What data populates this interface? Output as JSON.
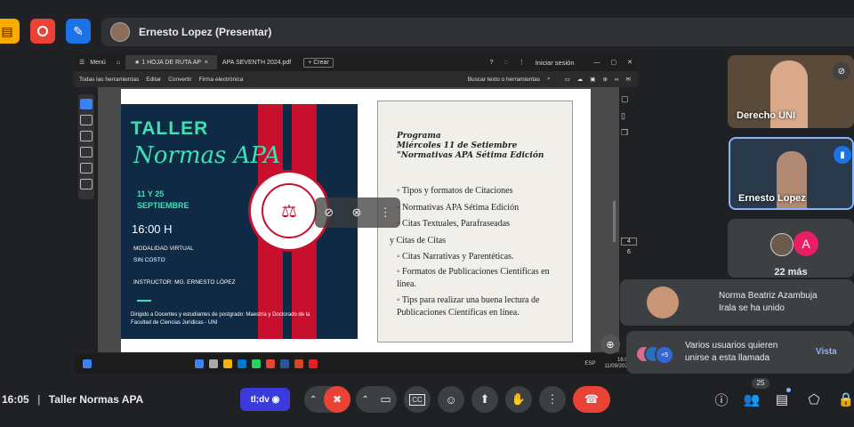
{
  "presenter": {
    "label": "Ernesto Lopez (Presentar)"
  },
  "window": {
    "menu_label": "Menú",
    "tabs": [
      "1 HOJA DE RUTA AP",
      "APA SEVENTH 2024.pdf"
    ],
    "new_tab": "+ Crear",
    "signin": "Iniciar sesión",
    "toolbar": [
      "Todas las herramientas",
      "Editar",
      "Convertir",
      "Firma electrónica"
    ],
    "search_placeholder": "Buscar texto o herramientas",
    "page_num": "4",
    "page_total": "6",
    "taskbar_lang": "ESP",
    "taskbar_time": "16:05",
    "taskbar_date": "11/09/2024"
  },
  "poster": {
    "taller": "TALLER",
    "normas": "Normas APA",
    "dates_line1": "11 Y 25",
    "dates_line2": "SEPTIEMBRE",
    "hora": "16:00 H",
    "modalidad": "MODALIDAD VIRTUAL",
    "costo": "SIN COSTO",
    "instructor": "INSTRUCTOR: MG. ERNESTO LÓPEZ",
    "dirigido_line1": "Dirigido a Docentes y estudiantes de postgrado: Maestría y Doctorado de la",
    "dirigido_line2": "Facultad de Ciencias Jurídicas - UNI"
  },
  "programa": {
    "title": "Programa",
    "date": "Miércoles 11 de Setiembre",
    "subtitle": "\"Normativas APA Sétima Edición",
    "items": [
      "Tipos y formatos de Citaciones",
      "Normativas APA Sétima Edición",
      "Citas Textuales, Parafraseadas",
      "y Citas de Citas",
      "Citas Narrativas y Parentéticas.",
      "Formatos de Publicaciones Científicas en línea.",
      "Tips para realizar una buena lectura de Publicaciones Científicas en línea."
    ]
  },
  "participants": {
    "tile1": "Derecho UNI",
    "tile2": "Ernesto Lopez",
    "more_avatar": "A",
    "more_label": "22 más"
  },
  "notifications": {
    "joined_name": "Norma Beatriz Azambuja",
    "joined_text": "Irala se ha unido",
    "req_badge": "+5",
    "req_text_line1": "Varios usuarios quieren",
    "req_text_line2": "unirse a esta llamada",
    "req_action": "Vista"
  },
  "meeting": {
    "time": "16:05",
    "separator": "|",
    "name": "Taller Normas APA",
    "brand_chip": "tl;dv",
    "participant_count": "25"
  },
  "colors": {
    "accent": "#1a73e8",
    "end_call": "#ea4335",
    "mute_red": "#ea4335",
    "poster_teal": "#3ee0b5",
    "poster_red": "#c8102e"
  }
}
